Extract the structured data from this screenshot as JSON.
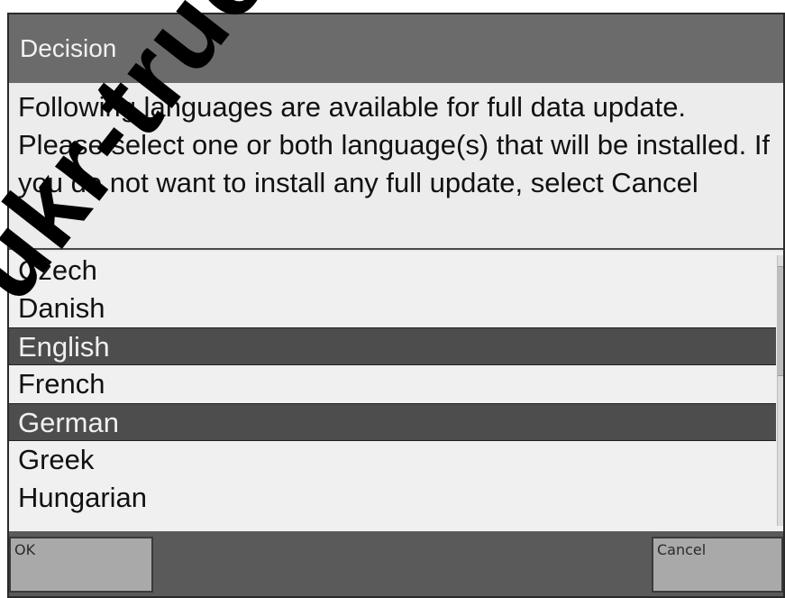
{
  "dialog": {
    "title": "Decision",
    "message": "Following languages are available for full data update. Please select one or both language(s) that will be installed. If you do not want to install any full update, select Cancel"
  },
  "languages": [
    {
      "label": "Czech",
      "selected": false
    },
    {
      "label": "Danish",
      "selected": false
    },
    {
      "label": "English",
      "selected": true
    },
    {
      "label": "French",
      "selected": false
    },
    {
      "label": "German",
      "selected": true
    },
    {
      "label": "Greek",
      "selected": false
    },
    {
      "label": "Hungarian",
      "selected": false
    }
  ],
  "buttons": {
    "ok_label": "OK",
    "cancel_label": "Cancel"
  },
  "watermark": {
    "text": "ukr-truck.c"
  },
  "colors": {
    "title_bar": "#6b6b6b",
    "selection": "#4d4d4d",
    "button_bar": "#5a5a5a",
    "button_face": "#a9a9a9"
  }
}
